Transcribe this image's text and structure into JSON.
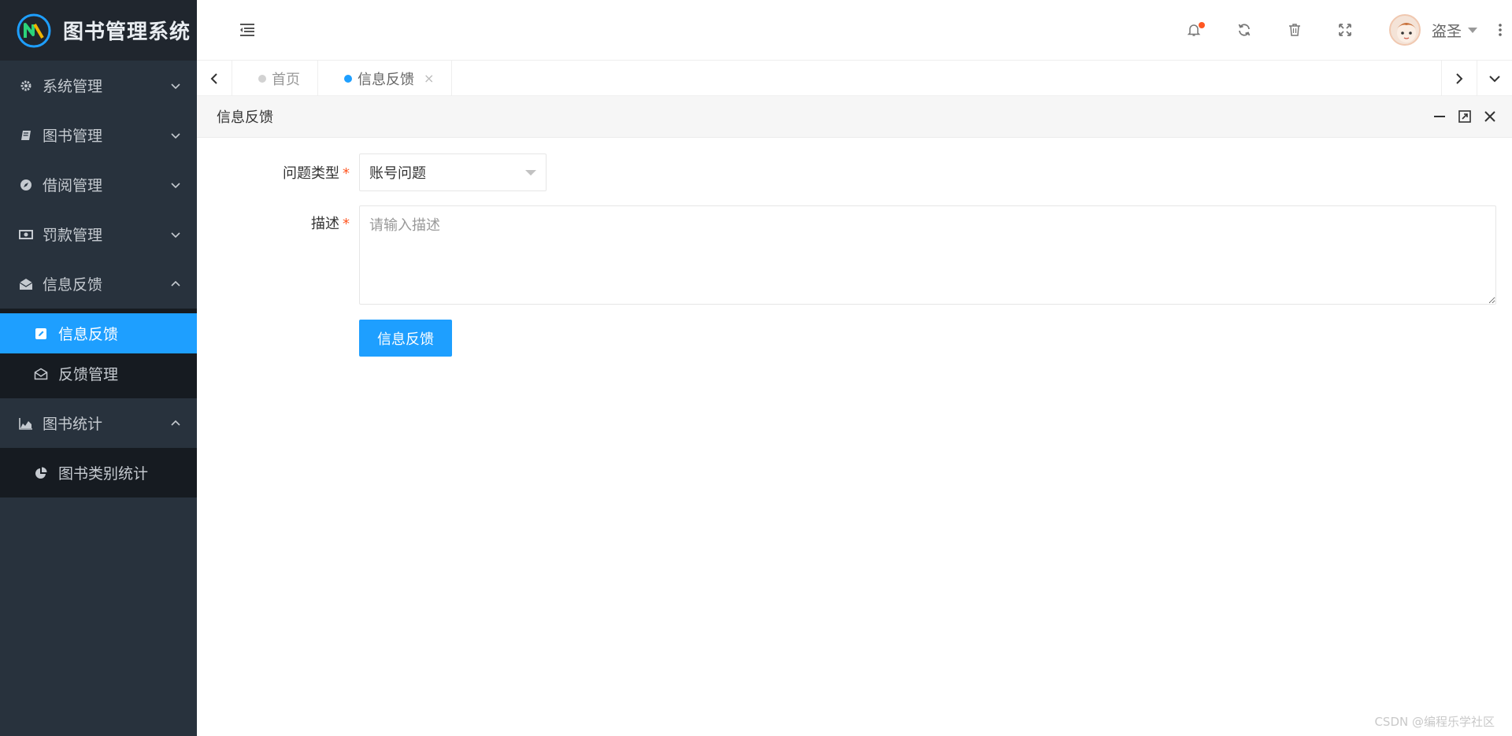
{
  "app": {
    "title": "图书管理系统"
  },
  "sidebar": {
    "menus": [
      {
        "label": "系统管理",
        "icon": "gear-icon"
      },
      {
        "label": "图书管理",
        "icon": "book-icon"
      },
      {
        "label": "借阅管理",
        "icon": "compass-icon"
      },
      {
        "label": "罚款管理",
        "icon": "money-icon"
      },
      {
        "label": "信息反馈",
        "icon": "envelope-open-icon"
      },
      {
        "label": "图书统计",
        "icon": "area-chart-icon"
      }
    ],
    "feedback_sub": [
      {
        "label": "信息反馈",
        "icon": "edit-icon",
        "active": true
      },
      {
        "label": "反馈管理",
        "icon": "envelope-outline-icon",
        "active": false
      }
    ],
    "stats_sub": [
      {
        "label": "图书类别统计",
        "icon": "pie-chart-icon",
        "active": false
      }
    ]
  },
  "header": {
    "user_name": "盗圣",
    "icons": [
      "bell-icon",
      "refresh-icon",
      "trash-icon",
      "fullscreen-icon",
      "more-vertical-icon"
    ],
    "notification_dot_color": "#ff5722"
  },
  "tabs": {
    "items": [
      {
        "label": "首页",
        "active": false,
        "closable": false
      },
      {
        "label": "信息反馈",
        "active": true,
        "closable": true
      }
    ],
    "close_glyph": "×"
  },
  "panel": {
    "title": "信息反馈"
  },
  "form": {
    "type_label": "问题类型",
    "type_value": "账号问题",
    "desc_label": "描述",
    "desc_placeholder": "请输入描述",
    "required_mark": "*",
    "submit_label": "信息反馈"
  },
  "watermark": "CSDN @编程乐学社区",
  "colors": {
    "accent": "#1e9fff",
    "sidebar_bg": "#28323d",
    "sidebar_sub_bg": "#161b21",
    "required": "#ff5722"
  }
}
